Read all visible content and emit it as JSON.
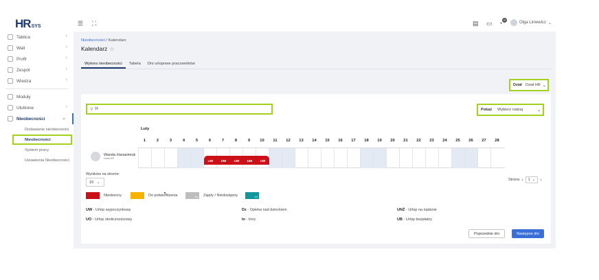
{
  "logo": {
    "hr": "HR",
    "sys": "SYS"
  },
  "sidebar": {
    "items": [
      {
        "label": "Tablica",
        "icon": "dashboard-icon"
      },
      {
        "label": "Wall",
        "icon": "wall-icon"
      },
      {
        "label": "Profil",
        "icon": "profile-icon"
      },
      {
        "label": "Zespół",
        "icon": "team-icon"
      },
      {
        "label": "Wiedza",
        "icon": "knowledge-icon"
      },
      {
        "label": "Moduły",
        "icon": "modules-icon"
      },
      {
        "label": "Ulubione",
        "icon": "star-icon"
      },
      {
        "label": "Nieobecności",
        "icon": "absence-icon"
      }
    ],
    "subitems": [
      {
        "label": "Dodawanie nieobecności"
      },
      {
        "label": "Nieobecności"
      },
      {
        "label": "System pracy"
      },
      {
        "label": "Ustawienia Nieobecności"
      }
    ]
  },
  "topbar": {
    "notification_count": "0",
    "user_name": "Olga Limewicz"
  },
  "breadcrumb": {
    "link": "Nieobecności",
    "sep": " / ",
    "current": "Kalendarz"
  },
  "page_title": "Kalendarz",
  "tabs": [
    {
      "label": "Wykres nieobecności"
    },
    {
      "label": "Tabela"
    },
    {
      "label": "Dni urlopowe pracowników"
    }
  ],
  "filters": {
    "dzial_label": "Dział",
    "dzial_value": "Dział HR",
    "search_value": "H",
    "pokaz_label": "Pokaż",
    "pokaz_value": "Wybierz rodzaj"
  },
  "calendar": {
    "month": "Luty",
    "days": [
      "1",
      "2",
      "3",
      "4",
      "5",
      "6",
      "7",
      "8",
      "9",
      "10",
      "11",
      "12",
      "13",
      "14",
      "15",
      "16",
      "17",
      "18",
      "19",
      "20",
      "21",
      "22",
      "23",
      "24",
      "25",
      "26",
      "27",
      "28"
    ],
    "weekend_days": [
      4,
      5,
      11,
      12,
      18,
      19,
      25,
      26
    ],
    "employee": {
      "name": "Wanda Harasimiuk",
      "department": "Dział HR"
    },
    "absences": [
      {
        "day": 6,
        "code": "UW"
      },
      {
        "day": 7,
        "code": "UW"
      },
      {
        "day": 8,
        "code": "UW"
      },
      {
        "day": 9,
        "code": "UW"
      },
      {
        "day": 10,
        "code": "UW"
      }
    ]
  },
  "pagination": {
    "per_page_label": "Wyników na stronie:",
    "per_page_value": "10",
    "page_label": "Strona",
    "page_value": "1"
  },
  "legend": [
    {
      "label": "Nieobecny",
      "color": "#cc1017",
      "badge": ""
    },
    {
      "label": "Do potwierdzenia",
      "color": "#f5b300",
      "badge": ""
    },
    {
      "label": "Zajęty / Niedostępny",
      "color": "#bdbdbd",
      "badge": "Zz"
    },
    {
      "label": "",
      "color": "#13969b",
      "badge": "14"
    }
  ],
  "codes": [
    {
      "code": "UW",
      "desc": " - Urlop wypoczynkowy"
    },
    {
      "code": "UO",
      "desc": " - Urlop okolicznościowy"
    },
    {
      "code": "Dz",
      "desc": " - Opieka nad dzieckiem"
    },
    {
      "code": "In",
      "desc": " - Inny"
    },
    {
      "code": "UNŻ",
      "desc": " - Urlop na żądanie"
    },
    {
      "code": "UB",
      "desc": " - Urlop bezpłatny"
    }
  ],
  "buttons": {
    "prev": "Poprzednie dni",
    "next": "Następne dni"
  },
  "colors": {
    "accent": "#3b6fd8",
    "highlight": "#a3d11c",
    "absent": "#cc1017",
    "brand": "#1e3a6d"
  }
}
